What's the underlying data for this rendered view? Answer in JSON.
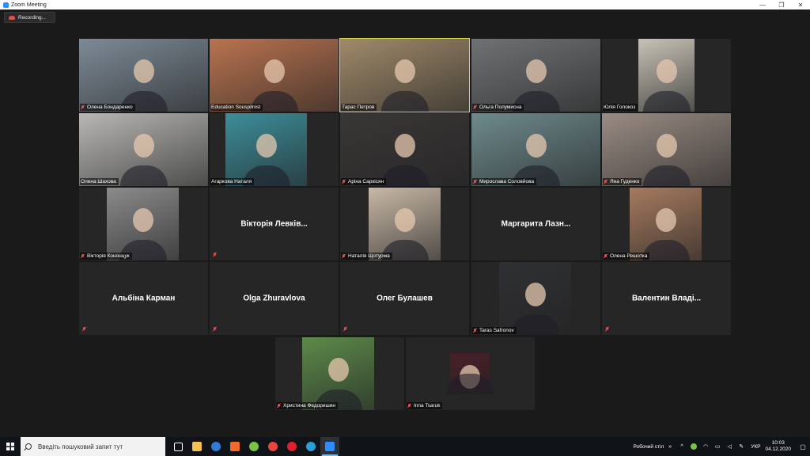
{
  "window": {
    "title": "Zoom Meeting",
    "minimize": "—",
    "maximize": "❐",
    "close": "✕"
  },
  "recording": {
    "label": "Recording..."
  },
  "participants": [
    {
      "name": "Олена Бондаренко",
      "muted": true,
      "video": true,
      "bg": "#7d8a96",
      "active": false
    },
    {
      "name": "Education Souspilnist",
      "muted": false,
      "video": true,
      "bg": "#b9734f",
      "active": false
    },
    {
      "name": "Тарас Петров",
      "muted": false,
      "video": true,
      "bg": "#a08a6a",
      "active": true
    },
    {
      "name": "Ольга Полумисна",
      "muted": true,
      "video": true,
      "bg": "#6f7274",
      "active": false
    },
    {
      "name": "Юлія Голокоз",
      "muted": false,
      "video": true,
      "bg": "#c7c2b6",
      "active": false
    },
    {
      "name": "Олена Шахова",
      "muted": false,
      "video": true,
      "bg": "#b8b7b4",
      "active": false
    },
    {
      "name": "Агаркова Наталя",
      "muted": false,
      "video": true,
      "bg": "#3c8e9a",
      "active": false
    },
    {
      "name": "Аріна Саркісян",
      "muted": true,
      "video": true,
      "bg": "#3a3636",
      "active": false
    },
    {
      "name": "Мирослава Соловйова",
      "muted": true,
      "video": true,
      "bg": "#6e8a8c",
      "active": false
    },
    {
      "name": "Яна Гуденко",
      "muted": true,
      "video": true,
      "bg": "#9a8c84",
      "active": false
    },
    {
      "name": "Вікторія Кононцук",
      "muted": true,
      "video": true,
      "bg": "#8b8b8b",
      "active": false
    },
    {
      "name": "Вікторія Левків...",
      "muted": true,
      "video": false,
      "active": false
    },
    {
      "name": "Наталія Щотурма",
      "muted": true,
      "video": true,
      "bg": "#c8b8a6",
      "active": false
    },
    {
      "name": "Маргарита Лазн...",
      "muted": false,
      "video": false,
      "active": false
    },
    {
      "name": "Олена Решотка",
      "muted": true,
      "video": true,
      "bg": "#a57a5f",
      "active": false
    },
    {
      "name": "Альбіна Карман",
      "muted": true,
      "video": false,
      "active": false
    },
    {
      "name": "Olga Zhuravlova",
      "muted": true,
      "video": false,
      "active": false
    },
    {
      "name": "Олег Булашев",
      "muted": true,
      "video": false,
      "active": false
    },
    {
      "name": "Taras Safronov",
      "muted": true,
      "video": true,
      "bg": "#2f3033",
      "active": false
    },
    {
      "name": "Валентин Владі...",
      "muted": true,
      "video": false,
      "active": false
    },
    {
      "name": "Христина Федоришин",
      "muted": true,
      "video": true,
      "bg": "#5d8a4a",
      "active": false
    },
    {
      "name": "Inna Tsaruk",
      "muted": true,
      "video": true,
      "bg": "#4a1f28",
      "active": false
    }
  ],
  "taskbar": {
    "search_placeholder": "Введіть пошуковий запит тут",
    "apps": [
      {
        "name": "task-view",
        "color": "#ffffff"
      },
      {
        "name": "file-explorer",
        "color": "#f2c14e"
      },
      {
        "name": "search-app",
        "color": "#2f7bd6"
      },
      {
        "name": "paint",
        "color": "#f06a2a"
      },
      {
        "name": "torrent",
        "color": "#7cc242"
      },
      {
        "name": "chrome",
        "color": "#e8453c"
      },
      {
        "name": "opera",
        "color": "#e0202d"
      },
      {
        "name": "edge",
        "color": "#2b9ed9"
      },
      {
        "name": "zoom",
        "color": "#2d8cff"
      }
    ],
    "desktop_label": "Робочий стіл",
    "chevron": "»",
    "lang": "УКР",
    "time": "10:03",
    "date": "04.12.2020"
  }
}
